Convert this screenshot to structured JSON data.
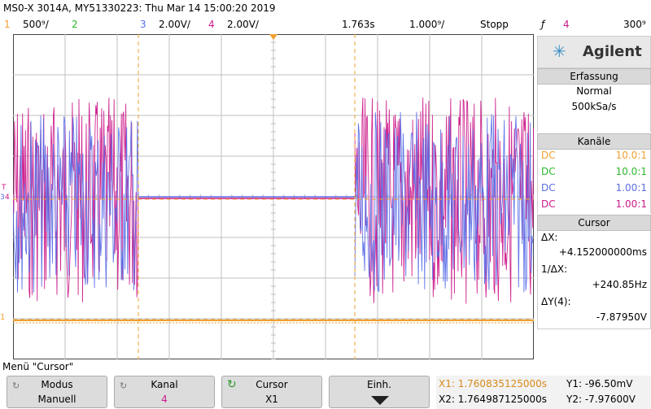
{
  "title": "MS0-X 3014A, MY51330223: Thu Mar 14 15:00:20 2019",
  "header": {
    "ch1_num": "1",
    "ch1_scale": "500⁹/",
    "ch2_num": "2",
    "ch3_num": "3",
    "ch3_scale": "2.00V/",
    "ch4_num": "4",
    "ch4_scale": "2.00V/",
    "timebase_pos": "1.763s",
    "timebase_scale": "1.000⁹/",
    "run_state": "Stopp",
    "trigger_icon": "ƒ",
    "trigger_ch": "4",
    "trigger_level": "300⁹"
  },
  "logo": {
    "text": "Agilent",
    "icon": "agilent-spark-icon"
  },
  "acquisition": {
    "title": "Erfassung",
    "mode": "Normal",
    "rate": "500kSa/s"
  },
  "channels": {
    "title": "Kanäle",
    "rows": [
      {
        "coupling": "DC",
        "probe": "10.0:1",
        "color": "#f0a030"
      },
      {
        "coupling": "DC",
        "probe": "10.0:1",
        "color": "#2db82d"
      },
      {
        "coupling": "DC",
        "probe": "1.00:1",
        "color": "#5a6ee6"
      },
      {
        "coupling": "DC",
        "probe": "1.00:1",
        "color": "#cc1a8a"
      }
    ]
  },
  "cursor": {
    "title": "Cursor",
    "dx_label": "ΔX:",
    "dx_value": "+4.152000000ms",
    "inv_label": "1/ΔX:",
    "inv_value": "+240.85Hz",
    "dy_label": "ΔY(4):",
    "dy_value": "-7.87950V"
  },
  "menu": {
    "title": "Menü \"Cursor\"",
    "modus_label": "Modus",
    "modus_value": "Manuell",
    "kanal_label": "Kanal",
    "kanal_value": "4",
    "cursor_label": "Cursor",
    "cursor_value": "X1",
    "einh_label": "Einh."
  },
  "readout": {
    "x1": "X1: 1.760835125000s",
    "x2": "X2: 1.764987125000s",
    "y1": "Y1: -96.50mV",
    "y2": "Y2: -7.97600V"
  },
  "colors": {
    "ch1": "#f0a030",
    "ch2": "#2db82d",
    "ch3": "#5a6ee6",
    "ch4": "#cc1a8a",
    "cursor": "#f0a030"
  }
}
